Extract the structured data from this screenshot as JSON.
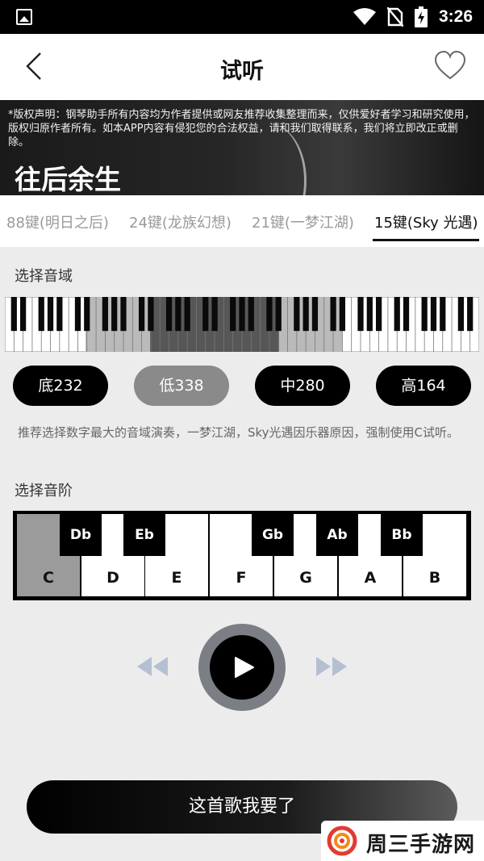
{
  "status_bar": {
    "time": "3:26"
  },
  "header": {
    "title": "试听"
  },
  "banner": {
    "notice": "*版权声明：钢琴助手所有内容均为作者提供或网友推荐收集整理而来，仅供爱好者学习和研究使用，版权归原作者所有。如本APP内容有侵犯您的合法权益，请和我们取得联系，我们将立即改正或删除。",
    "song_title": "往后余生"
  },
  "tabs": [
    {
      "label": "88键(明日之后)",
      "active": false
    },
    {
      "label": "24键(龙族幻想)",
      "active": false
    },
    {
      "label": "21键(一梦江湖)",
      "active": false
    },
    {
      "label": "15键(Sky 光遇)",
      "active": true
    }
  ],
  "range_section": {
    "label": "选择音域",
    "options": [
      {
        "label": "底232",
        "selected": false
      },
      {
        "label": "低338",
        "selected": true
      },
      {
        "label": "中280",
        "selected": false
      },
      {
        "label": "高164",
        "selected": false
      }
    ],
    "hint": "推荐选择数字最大的音域演奏，一梦江湖，Sky光遇因乐器原因，强制使用C试听。"
  },
  "scale_section": {
    "label": "选择音阶",
    "white_keys": [
      "C",
      "D",
      "E",
      "F",
      "G",
      "A",
      "B"
    ],
    "black_keys": [
      "Db",
      "Eb",
      "Gb",
      "Ab",
      "Bb"
    ],
    "selected_key": "C"
  },
  "cta": {
    "label": "这首歌我要了"
  },
  "watermark": {
    "text": "周三手游网"
  },
  "colors": {
    "selected_gray": "#9b9b9b",
    "play_ring": "#7c7e86",
    "control_blue": "#b4c0d2"
  }
}
